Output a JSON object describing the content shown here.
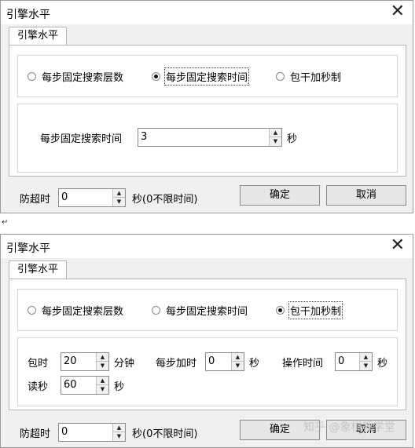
{
  "dialog1": {
    "title": "引擎水平",
    "close_glyph": "✕",
    "tab": "引擎水平",
    "radios": [
      {
        "label": "每步固定搜索层数",
        "checked": false
      },
      {
        "label": "每步固定搜索时间",
        "checked": true
      },
      {
        "label": "包干加秒制",
        "checked": false
      }
    ],
    "time_label": "每步固定搜索时间",
    "time_value": "3",
    "time_unit": "秒",
    "timeout_label": "防超时",
    "timeout_value": "0",
    "timeout_note": "秒(0不限时间)",
    "ok": "确定",
    "cancel": "取消"
  },
  "separator": "↵",
  "dialog2": {
    "title": "引擎水平",
    "close_glyph": "✕",
    "tab": "引擎水平",
    "radios": [
      {
        "label": "每步固定搜索层数",
        "checked": false
      },
      {
        "label": "每步固定搜索时间",
        "checked": false
      },
      {
        "label": "包干加秒制",
        "checked": true
      }
    ],
    "baoshi_label": "包时",
    "baoshi_value": "20",
    "baoshi_unit": "分钟",
    "jiashi_label": "每步加时",
    "jiashi_value": "0",
    "jiashi_unit": "秒",
    "caozuo_label": "操作时间",
    "caozuo_value": "0",
    "caozuo_unit": "秒",
    "dumiao_label": "读秒",
    "dumiao_value": "60",
    "dumiao_unit": "秒",
    "timeout_label": "防超时",
    "timeout_value": "0",
    "timeout_note": "秒(0不限时间)",
    "ok": "确定",
    "cancel": "取消"
  },
  "watermark": "知乎 @象棋教学堂"
}
